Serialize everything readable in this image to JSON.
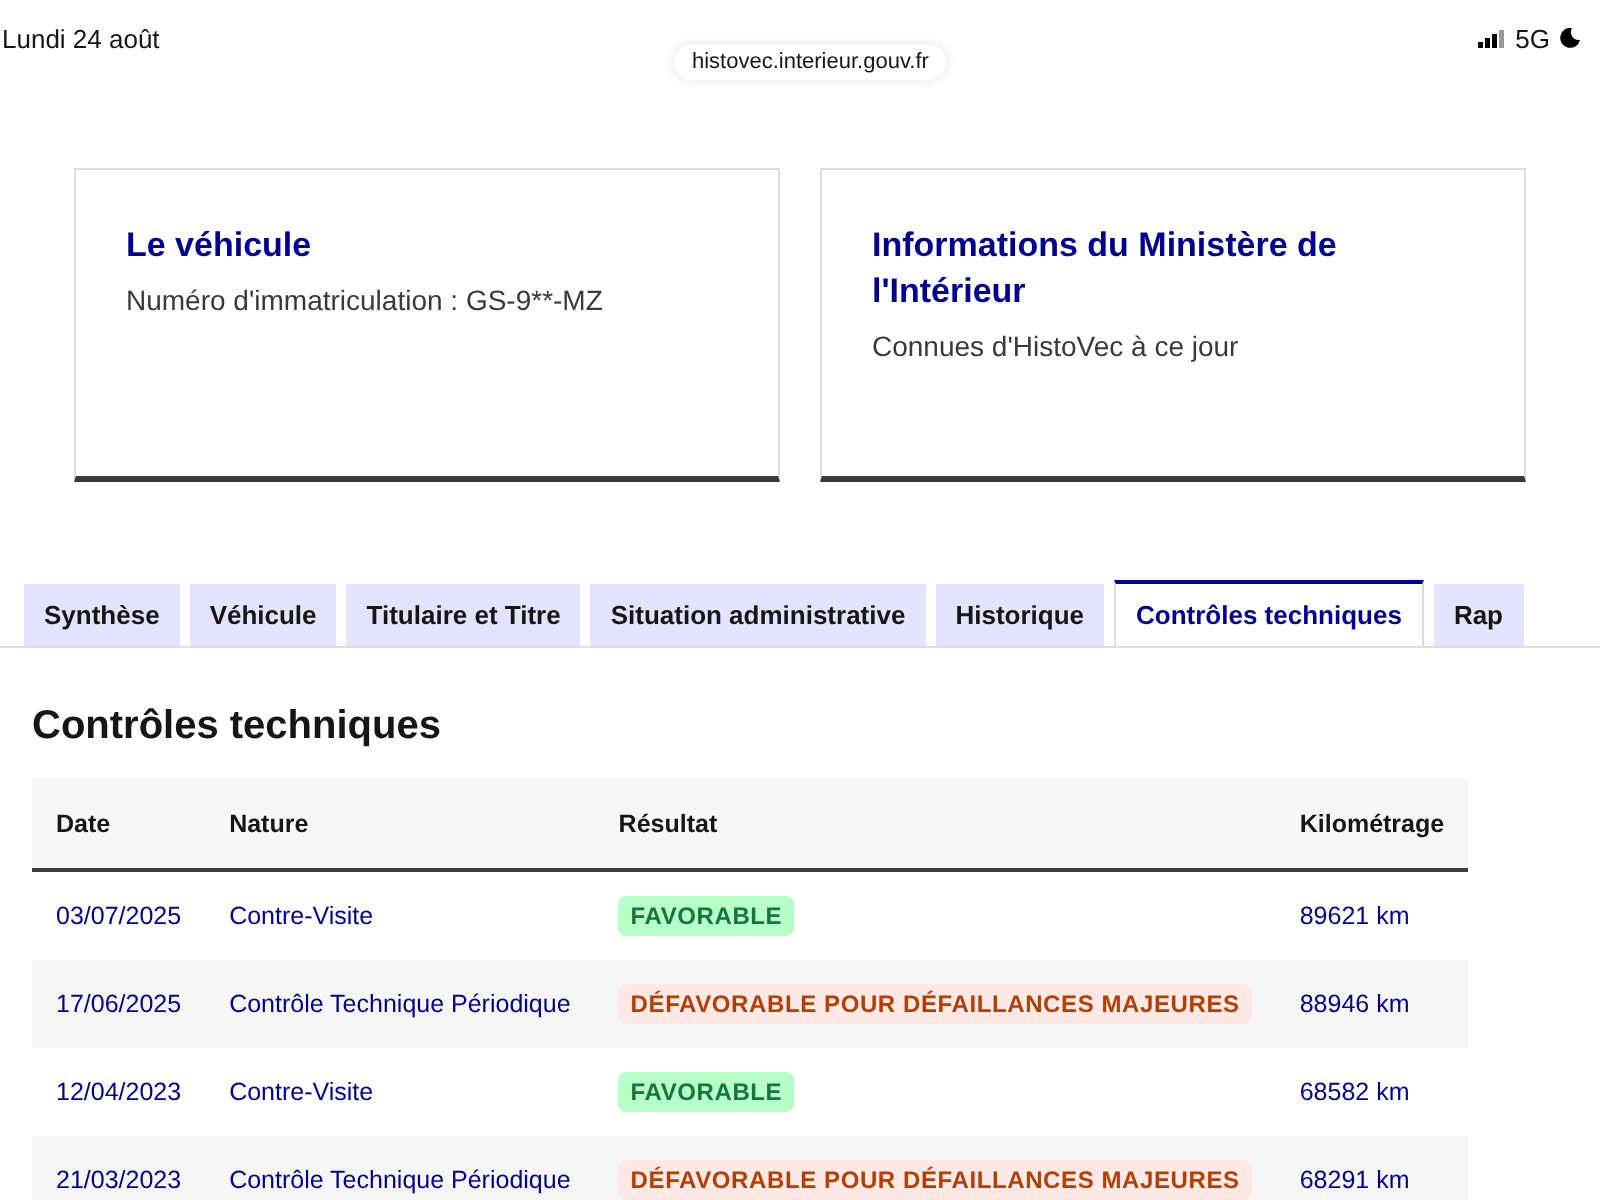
{
  "status_bar": {
    "date": "Lundi 24 août",
    "url": "histovec.interieur.gouv.fr",
    "network": "5G"
  },
  "cards": [
    {
      "title": "Le véhicule",
      "text": "Numéro d'immatriculation : GS-9**-MZ"
    },
    {
      "title": "Informations du Ministère de l'Intérieur",
      "text": "Connues d'HistoVec à ce jour"
    }
  ],
  "tabs": [
    {
      "label": "Synthèse",
      "selected": false
    },
    {
      "label": "Véhicule",
      "selected": false
    },
    {
      "label": "Titulaire et Titre",
      "selected": false
    },
    {
      "label": "Situation administrative",
      "selected": false
    },
    {
      "label": "Historique",
      "selected": false
    },
    {
      "label": "Contrôles techniques",
      "selected": true
    },
    {
      "label": "Rap",
      "selected": false
    }
  ],
  "section_title": "Contrôles techniques",
  "table": {
    "columns": [
      "Date",
      "Nature",
      "Résultat",
      "Kilométrage"
    ],
    "rows": [
      {
        "date": "03/07/2025",
        "nature": "Contre-Visite",
        "result": "FAVORABLE",
        "kind": "favorable",
        "mileage": "89621 km"
      },
      {
        "date": "17/06/2025",
        "nature": "Contrôle Technique Périodique",
        "result": "DÉFAVORABLE POUR DÉFAILLANCES MAJEURES",
        "kind": "defavorable",
        "mileage": "88946 km"
      },
      {
        "date": "12/04/2023",
        "nature": "Contre-Visite",
        "result": "FAVORABLE",
        "kind": "favorable",
        "mileage": "68582 km"
      },
      {
        "date": "21/03/2023",
        "nature": "Contrôle Technique Périodique",
        "result": "DÉFAVORABLE POUR DÉFAILLANCES MAJEURES",
        "kind": "defavorable",
        "mileage": "68291 km"
      }
    ]
  }
}
